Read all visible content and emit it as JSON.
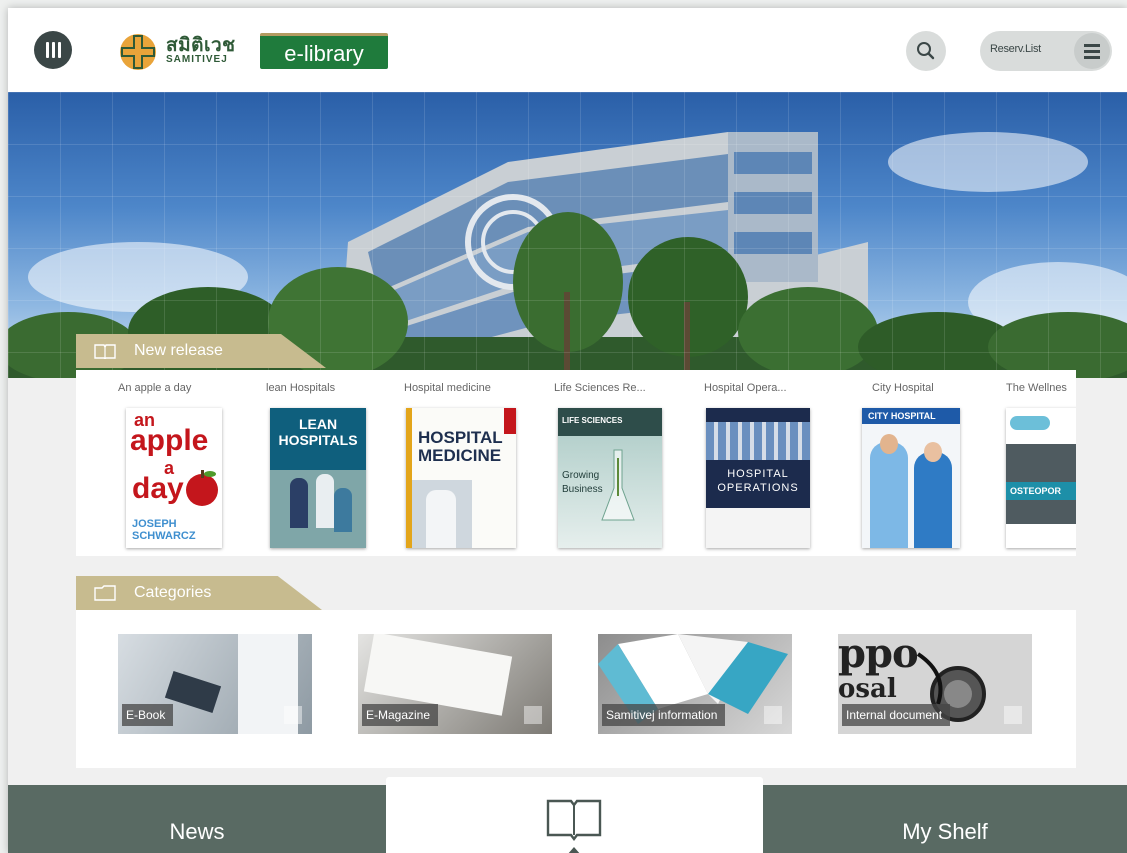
{
  "header": {
    "logo_thai": "สมิติเวช",
    "logo_en": "SAMITIVEJ",
    "logo_elibrary": "e-library",
    "reserve_label": "Reserv.List"
  },
  "new_release": {
    "title": "New release",
    "books": [
      {
        "title": "An apple a day"
      },
      {
        "title": "lean Hospitals"
      },
      {
        "title": "Hospital medicine"
      },
      {
        "title": "Life Sciences Re..."
      },
      {
        "title": "Hospital Opera..."
      },
      {
        "title": "City Hospital"
      },
      {
        "title": "The Wellnes"
      }
    ],
    "covers": {
      "apple": {
        "line1": "an",
        "line2": "apple",
        "line3": "a",
        "line4": "day",
        "author": "JOSEPH SCHWARCZ"
      },
      "lean": {
        "line1": "LEAN",
        "line2": "HOSPITALS"
      },
      "hospital_medicine": {
        "line1": "HOSPITAL",
        "line2": "MEDICINE"
      },
      "life_sciences": {
        "line1": "LIFE SCIENCES",
        "line2": "Growing",
        "line3": "Business"
      },
      "operations": {
        "line1": "HOSPITAL",
        "line2": "OPERATIONS"
      },
      "city": {
        "line1": "CITY HOSPITAL"
      },
      "wellness": {
        "line1": "OSTEOPOR"
      }
    }
  },
  "categories": {
    "title": "Categories",
    "items": [
      {
        "label": "E-Book"
      },
      {
        "label": "E-Magazine"
      },
      {
        "label": "Samitivej information"
      },
      {
        "label": "Internal document"
      }
    ]
  },
  "bottom_nav": {
    "news": "News",
    "my_shelf": "My Shelf"
  },
  "colors": {
    "brand_green": "#1f7b3c",
    "nav_bar": "#596a63",
    "tab_gold": "#c7bb8f",
    "header_dark": "#3b4747"
  }
}
